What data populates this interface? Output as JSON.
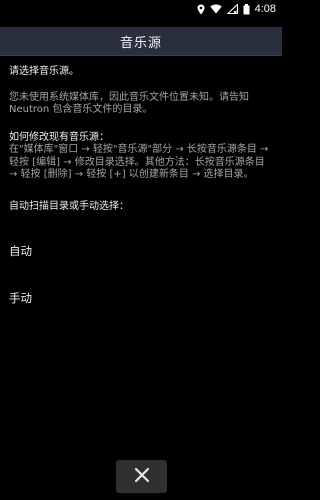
{
  "status_bar": {
    "time": "4:08"
  },
  "header": {
    "title": "音乐源"
  },
  "content": {
    "intro": "请选择音乐源。",
    "explanation": "您未使用系统媒体库，因此音乐文件位置未知。请告知 Neutron 包含音乐文件的目录。",
    "how_to_heading": "如何修改现有音乐源：",
    "how_to_body": "在\"媒体库\"窗口 → 轻按\"音乐源\"部分 → 长按音乐源条目 → 轻按 [编辑] → 修改目录选择。其他方法：长按音乐源条目 → 轻按 [删除] → 轻按 [+] 以创建新条目 → 选择目录。",
    "scan_prompt": "自动扫描目录或手动选择："
  },
  "options": {
    "auto_label": "自动",
    "manual_label": "手动"
  },
  "footer": {
    "close_icon": "close-icon"
  }
}
